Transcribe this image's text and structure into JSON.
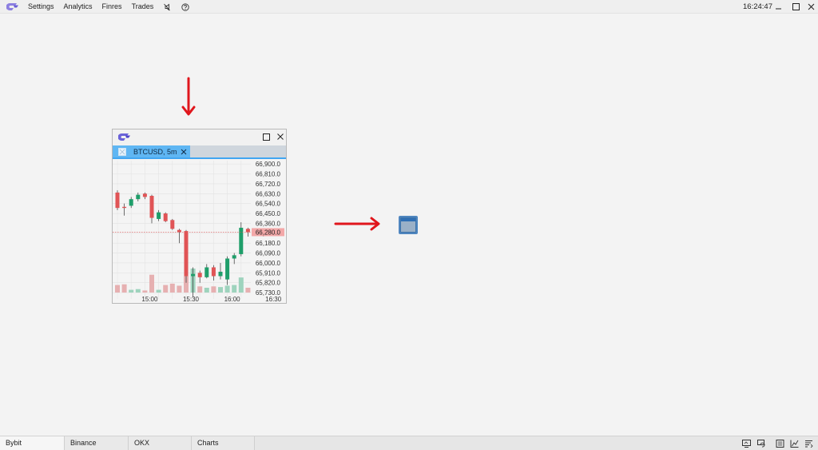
{
  "menu": {
    "settings": "Settings",
    "analytics": "Analytics",
    "finres": "Finres",
    "trades": "Trades",
    "icons": [
      "sound-off-icon",
      "help-icon"
    ]
  },
  "clock": "16:24:47",
  "window_controls": [
    "minimize-icon",
    "maximize-icon",
    "close-icon"
  ],
  "widget": {
    "tab_label": "BTCUSD, 5m",
    "icons": [
      "app-logo-icon",
      "maximize-icon",
      "close-icon",
      "chart-tab-icon",
      "tab-close-icon"
    ]
  },
  "colors": {
    "accent": "#41a6f2",
    "tab": "#5fb6f3",
    "up": "#1f9e6a",
    "down": "#e05456",
    "up_volume": "#9ed3bd",
    "down_volume": "#e6b0b1",
    "arrow": "#e0161c"
  },
  "chart_data": {
    "type": "candlestick",
    "y_ticks": [
      "66,900.0",
      "66,810.0",
      "66,720.0",
      "66,630.0",
      "66,540.0",
      "66,450.0",
      "66,360.0",
      "66,270.0",
      "66,180.0",
      "66,090.0",
      "66,000.0",
      "65,910.0",
      "65,820.0",
      "65,730.0"
    ],
    "y_tick_values": [
      66900,
      66810,
      66720,
      66630,
      66540,
      66450,
      66360,
      66270,
      66180,
      66090,
      66000,
      65910,
      65820,
      65730
    ],
    "x_ticks": [
      "15:00",
      "15:30",
      "16:00",
      "16:30"
    ],
    "x_tick_index": [
      4,
      10,
      16,
      22
    ],
    "ylim": [
      65680,
      66930
    ],
    "current_price_label": "66,280.0",
    "current_price": 66280,
    "candles": [
      {
        "o": 66640,
        "h": 66660,
        "l": 66480,
        "c": 66500
      },
      {
        "o": 66510,
        "h": 66540,
        "l": 66430,
        "c": 66500
      },
      {
        "o": 66520,
        "h": 66600,
        "l": 66500,
        "c": 66580
      },
      {
        "o": 66580,
        "h": 66640,
        "l": 66560,
        "c": 66620
      },
      {
        "o": 66630,
        "h": 66640,
        "l": 66580,
        "c": 66600
      },
      {
        "o": 66610,
        "h": 66620,
        "l": 66360,
        "c": 66410
      },
      {
        "o": 66400,
        "h": 66480,
        "l": 66380,
        "c": 66460
      },
      {
        "o": 66450,
        "h": 66460,
        "l": 66370,
        "c": 66380
      },
      {
        "o": 66390,
        "h": 66400,
        "l": 66300,
        "c": 66310
      },
      {
        "o": 66300,
        "h": 66310,
        "l": 66180,
        "c": 66280
      },
      {
        "o": 66290,
        "h": 66300,
        "l": 65820,
        "c": 65880
      },
      {
        "o": 65880,
        "h": 65960,
        "l": 65690,
        "c": 65900
      },
      {
        "o": 65910,
        "h": 65930,
        "l": 65820,
        "c": 65870
      },
      {
        "o": 65870,
        "h": 65990,
        "l": 65860,
        "c": 65960
      },
      {
        "o": 65960,
        "h": 65980,
        "l": 65840,
        "c": 65880
      },
      {
        "o": 65880,
        "h": 66000,
        "l": 65850,
        "c": 65920
      },
      {
        "o": 65850,
        "h": 66060,
        "l": 65800,
        "c": 66040
      },
      {
        "o": 66040,
        "h": 66090,
        "l": 65990,
        "c": 66070
      },
      {
        "o": 66080,
        "h": 66370,
        "l": 66060,
        "c": 66320
      },
      {
        "o": 66310,
        "h": 66320,
        "l": 66240,
        "c": 66280
      }
    ],
    "volumes": [
      22,
      24,
      8,
      10,
      6,
      52,
      8,
      22,
      26,
      20,
      48,
      70,
      18,
      14,
      18,
      16,
      20,
      22,
      44,
      14
    ]
  },
  "bottom": {
    "tabs": [
      "Bybit",
      "Binance",
      "OKX",
      "Charts"
    ],
    "icons": [
      "screen-icon",
      "refresh-screen-icon",
      "list-icon",
      "chart-line-icon",
      "filter-list-icon"
    ]
  }
}
